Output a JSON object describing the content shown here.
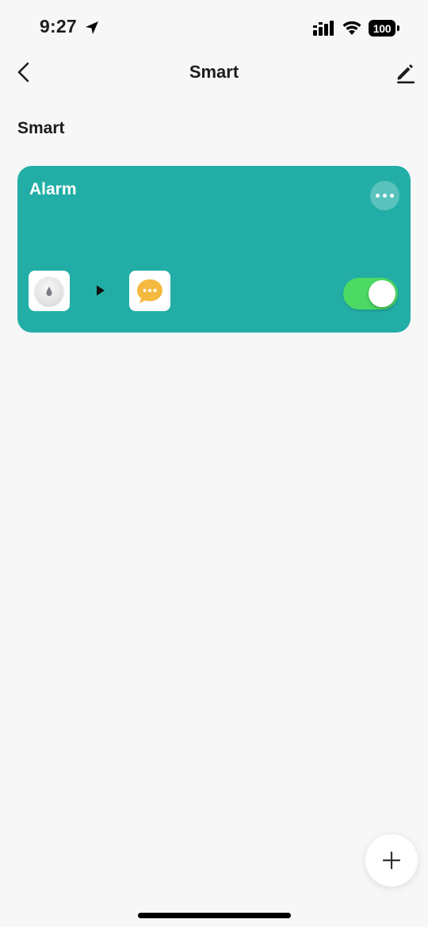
{
  "status_bar": {
    "time": "9:27",
    "battery": "100",
    "icons": [
      "location-arrow-icon",
      "cellular-signal-icon",
      "wifi-icon",
      "battery-icon"
    ]
  },
  "nav": {
    "title": "Smart",
    "back_icon": "chevron-left-icon",
    "edit_icon": "pencil-icon"
  },
  "section": {
    "title": "Smart"
  },
  "scene": {
    "name": "Alarm",
    "enabled": true,
    "color": "#22aea6",
    "toggle_color": "#4cd964",
    "trigger_icon": "water-leak-sensor-icon",
    "arrow_icon": "play-arrow-icon",
    "action_icon": "message-bubble-icon",
    "more_icon": "more-dots-icon"
  },
  "fab": {
    "icon": "plus-icon"
  }
}
